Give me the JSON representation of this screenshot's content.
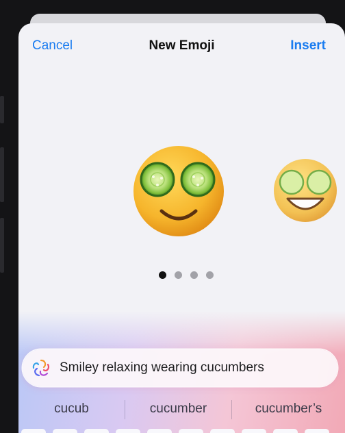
{
  "header": {
    "cancel_label": "Cancel",
    "title": "New Emoji",
    "insert_label": "Insert"
  },
  "carousel": {
    "page_count": 4,
    "active_index": 0
  },
  "prompt": {
    "text": "Smiley relaxing wearing cucumbers",
    "icon": "image-playground-icon"
  },
  "suggestions": [
    "cucub",
    "cucumber",
    "cucumber’s"
  ],
  "colors": {
    "accent": "#1a7cf0",
    "sheet_background": "#f2f2f6",
    "emoji_face": "#f6b52c",
    "cucumber": "#8cc63f"
  }
}
